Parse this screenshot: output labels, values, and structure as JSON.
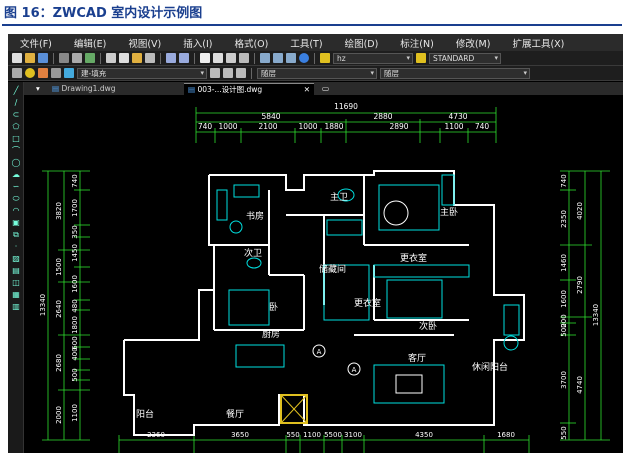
{
  "caption": "图 16：ZWCAD 室内设计示例图",
  "menu": [
    "文件(F)",
    "编辑(E)",
    "视图(V)",
    "插入(I)",
    "格式(O)",
    "工具(T)",
    "绘图(D)",
    "标注(N)",
    "修改(M)",
    "扩展工具(X)"
  ],
  "toolbar2": {
    "layer_name": "建-填充",
    "font_value": "hz",
    "style_value": "STANDARD",
    "layer_dd": "随层",
    "linetype_dd": "随层"
  },
  "tabs": {
    "tab1": "Drawing1.dwg",
    "tab2": "003-...设计图.dwg"
  },
  "colors": {
    "dim": "#2fe02f",
    "wall": "#ffffff",
    "furniture": "#00e0e0",
    "text": "#ffffff",
    "accent_yellow": "#e0c020"
  },
  "drawing": {
    "top_dims": {
      "total": "11690",
      "row2": [
        "5840",
        "2880",
        "4730"
      ],
      "row3": [
        "740",
        "1000",
        "2100",
        "1000",
        "1880",
        "2890",
        "1100",
        "740"
      ]
    },
    "left_dims": {
      "outer": "13340",
      "col1": [
        "3820",
        "1500",
        "2640",
        "2680",
        "2000"
      ],
      "col2": [
        "740",
        "1700",
        "350",
        "1450",
        "1600",
        "480",
        "1800",
        "600",
        "400",
        "500",
        "1100"
      ]
    },
    "right_dims": {
      "outer": "13340",
      "col1": [
        "4020",
        "2790",
        "4740"
      ],
      "col2": [
        "740",
        "2350",
        "1460",
        "1600",
        "200",
        "500",
        "3700",
        "550"
      ]
    },
    "bottom_dims": {
      "row1": [
        "2360",
        "3650",
        "550",
        "1100",
        "5500",
        "3100",
        "4350",
        "1680"
      ]
    },
    "rooms": [
      "主卫",
      "书房",
      "主卧",
      "次卫",
      "储藏间",
      "更衣室",
      "更衣室",
      "次卧",
      "卧",
      "厨房",
      "客厅",
      "休闲阳台",
      "阳台",
      "餐厅"
    ],
    "markers": [
      "A",
      "A"
    ]
  }
}
